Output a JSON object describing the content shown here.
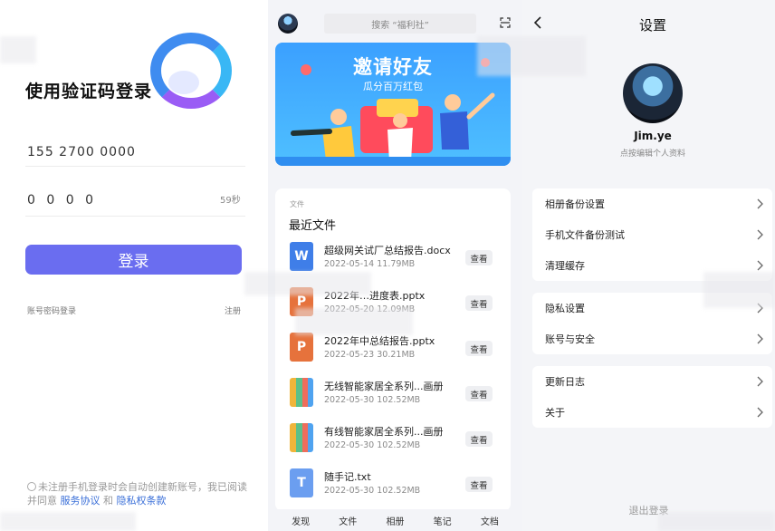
{
  "login": {
    "title": "使用验证码登录",
    "phone_value": "155 2700 0000",
    "code_value": "0 0 0 0",
    "countdown": "59秒",
    "login_button": "登录",
    "password_login": "账号密码登录",
    "register": "注册",
    "agree_text": "未注册手机登录时会自动创建新账号，我已阅读并同意",
    "service_agreement": "服务协议",
    "and": "和",
    "privacy_policy": "隐私权条款"
  },
  "files": {
    "search_placeholder": "搜索 “福利社”",
    "banner_title": "邀请好友",
    "banner_subtitle": "瓜分百万红包",
    "section_label": "文件",
    "recent_title": "最近文件",
    "view_label": "查看",
    "items": [
      {
        "name": "超级网关试厂总结报告.docx",
        "date": "2022-05-14",
        "size": "11.79MB",
        "type": "word",
        "glyph": "W"
      },
      {
        "name": "2022年…进度表.pptx",
        "date": "2022-05-20",
        "size": "12.09MB",
        "type": "ppt",
        "glyph": "P"
      },
      {
        "name": "2022年中总结报告.pptx",
        "date": "2022-05-23",
        "size": "30.21MB",
        "type": "ppt",
        "glyph": "P"
      },
      {
        "name": "无线智能家居全系列...画册",
        "date": "2022-05-30",
        "size": "102.52MB",
        "type": "zip",
        "glyph": ""
      },
      {
        "name": "有线智能家居全系列...画册",
        "date": "2022-05-30",
        "size": "102.52MB",
        "type": "zip",
        "glyph": ""
      },
      {
        "name": "随手记.txt",
        "date": "2022-05-30",
        "size": "102.52MB",
        "type": "txt",
        "glyph": "T"
      }
    ],
    "nav": [
      "发现",
      "文件",
      "相册",
      "笔记",
      "文档"
    ]
  },
  "settings": {
    "title": "设置",
    "username": "Jim.ye",
    "edit_profile": "点按编辑个人资料",
    "group1": [
      "相册备份设置",
      "手机文件备份测试",
      "清理缓存"
    ],
    "group2": [
      "隐私设置",
      "账号与安全"
    ],
    "group3": [
      "更新日志",
      "关于"
    ],
    "logout": "退出登录"
  },
  "colors": {
    "accent": "#6a6df0",
    "link": "#3a6fd8"
  }
}
